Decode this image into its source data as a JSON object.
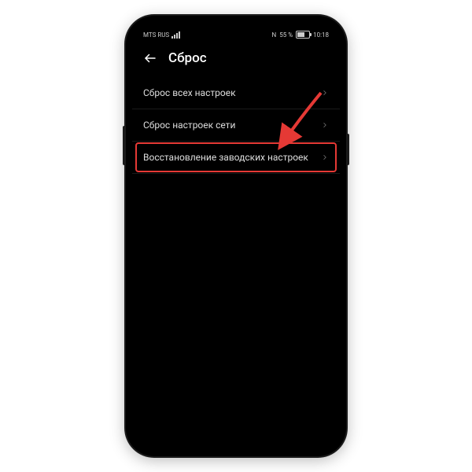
{
  "status": {
    "carrier": "MTS RUS",
    "nfc": "N",
    "battery_pct": "55 %",
    "time": "10:18"
  },
  "header": {
    "title": "Сброс"
  },
  "items": [
    {
      "label": "Сброс всех настроек"
    },
    {
      "label": "Сброс настроек сети"
    },
    {
      "label": "Восстановление заводских настроек"
    }
  ]
}
